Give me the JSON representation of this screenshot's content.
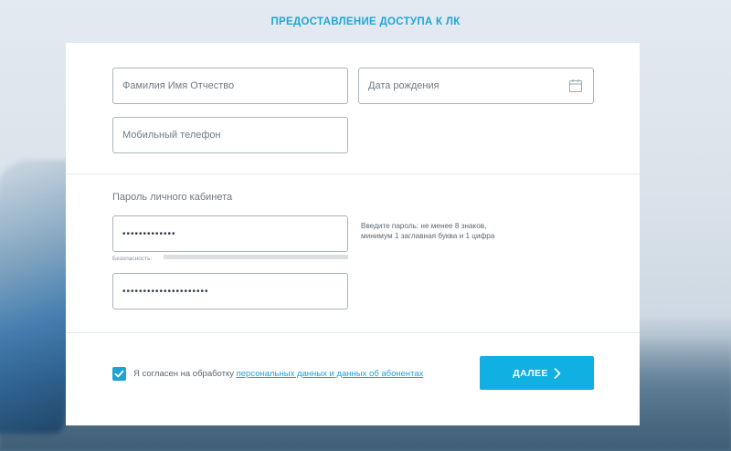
{
  "page": {
    "title": "ПРЕДОСТАВЛЕНИЕ ДОСТУПА К ЛК"
  },
  "personal": {
    "full_name_placeholder": "Фамилия Имя Отчество",
    "birth_date_placeholder": "Дата рождения",
    "phone_placeholder": "Мобильный телефон"
  },
  "password_section": {
    "label": "Пароль личного кабинета",
    "password_value": "•••••••••••••",
    "password_confirm_value": "•••••••••••••••••••••",
    "hint_line1": "Введите пароль: не менее 8 знаков,",
    "hint_line2": "минимум 1 заглавная буква и 1 цифра",
    "strength_label": "Безопасность:",
    "strength_level": 0
  },
  "consent": {
    "checked": true,
    "text": "Я согласен на обработку ",
    "link_text": "персональных данных и данных об абонентах"
  },
  "actions": {
    "next_label": "ДАЛЕЕ"
  },
  "colors": {
    "accent": "#1ea3d6",
    "button": "#10b0e3",
    "title": "#1fa6d9"
  }
}
